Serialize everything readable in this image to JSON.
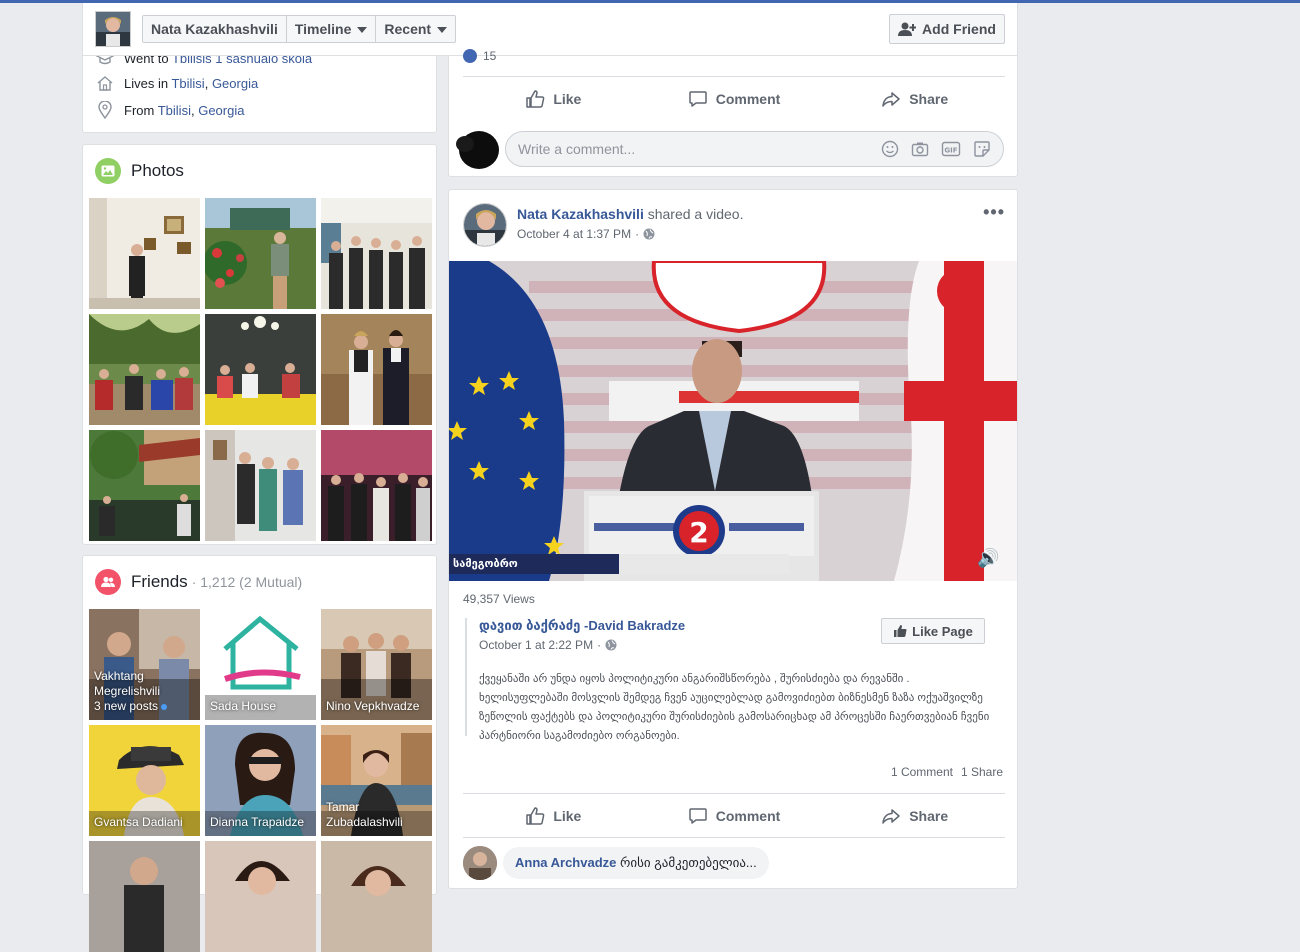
{
  "header": {
    "name": "Nata Kazakhashvili",
    "timeline_label": "Timeline",
    "recent_label": "Recent",
    "add_friend_label": "Add Friend"
  },
  "intro": {
    "went_to_prefix": "Went to",
    "went_to_place": "Tbilisis 1 sashualo skola",
    "lives_prefix": "Lives in",
    "lives_city": "Tbilisi",
    "lives_country": "Georgia",
    "from_prefix": "From",
    "from_city": "Tbilisi",
    "from_country": "Georgia"
  },
  "photos": {
    "title": "Photos"
  },
  "friends": {
    "title": "Friends",
    "count": "· 1,212 (2 Mutual)",
    "items": [
      {
        "name": "Vakhtang Megrelishvili",
        "sub": "3 new posts"
      },
      {
        "name": "Sada House"
      },
      {
        "name": "Nino Vepkhvadze"
      },
      {
        "name": "Gvantsa Dadiani"
      },
      {
        "name": "Dianna Trapaidze"
      },
      {
        "name": "Tamar Zubadalashvili"
      }
    ]
  },
  "post1": {
    "reactions_count": "15",
    "like_label": "Like",
    "comment_label": "Comment",
    "share_label": "Share",
    "comment_placeholder": "Write a comment..."
  },
  "post2": {
    "author": "Nata Kazakhashvili",
    "action": "shared a video.",
    "time": "October 4 at 1:37 PM",
    "views": "49,357 Views",
    "shared_name": "დავით ბაქრაძე -David Bakradze",
    "shared_time": "October 1 at 2:22 PM",
    "like_page_label": "Like Page",
    "shared_text": "ქვეყანაში არ უნდა იყოს პოლიტიკური ანგარიშსწორება , შურისძიება და რევანში . ხელისუფლებაში მოსვლის შემდეგ ჩვენ აუცილებლად გამოვიძიებთ ბიზნესმენ ზაზა ოქუაშვილზე ზეწოლის ფაქტებს და პოლიტიკური შურისძიების გამოსარიცხად ამ პროცესში ჩაერთვებიან ჩვენი პარტნიორი საგამოძიებო ორგანოები.",
    "comments_count": "1 Comment",
    "shares_count": "1 Share",
    "like_label": "Like",
    "comment_label": "Comment",
    "share_label": "Share",
    "video_banner_text": "სამეგობრო",
    "reply_author": "Anna Archvadze",
    "reply_text": "რისი გამკეთებელია..."
  },
  "colors": {
    "facebook_blue": "#4267b2",
    "link": "#385898",
    "photos_icon_bg": "#8fcf63",
    "friends_icon_bg": "#f35369"
  }
}
